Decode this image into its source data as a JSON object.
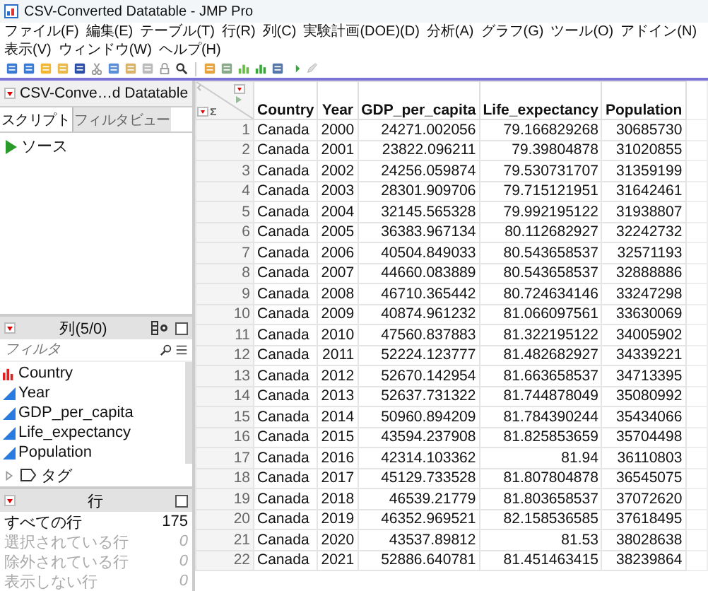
{
  "window": {
    "title": "CSV-Converted Datatable - JMP Pro"
  },
  "menu": [
    "ファイル(F)",
    "編集(E)",
    "テーブル(T)",
    "行(R)",
    "列(C)",
    "実験計画(DOE)(D)",
    "分析(A)",
    "グラフ(G)",
    "ツール(O)",
    "アドイン(N)",
    "表示(V)",
    "ウィンドウ(W)",
    "ヘルプ(H)"
  ],
  "table_panel": {
    "title": "CSV-Conve…d Datatable",
    "tabs": [
      {
        "label": "スクリプト",
        "selected": true
      },
      {
        "label": "フィルタビュー",
        "selected": false
      }
    ],
    "scripts": [
      "ソース"
    ]
  },
  "columns_panel": {
    "title": "列(5/0)",
    "filter": {
      "placeholder": "フィルタ"
    },
    "columns": [
      {
        "name": "Country",
        "kind": "nominal"
      },
      {
        "name": "Year",
        "kind": "continuous"
      },
      {
        "name": "GDP_per_capita",
        "kind": "continuous"
      },
      {
        "name": "Life_expectancy",
        "kind": "continuous"
      },
      {
        "name": "Population",
        "kind": "continuous"
      }
    ],
    "tags": "タグ"
  },
  "rows_panel": {
    "title": "行",
    "items": [
      {
        "label": "すべての行",
        "count": "175",
        "dimmed": false
      },
      {
        "label": "選択されている行",
        "count": "0",
        "dimmed": true
      },
      {
        "label": "除外されている行",
        "count": "0",
        "dimmed": true
      },
      {
        "label": "表示しない行",
        "count": "0",
        "dimmed": true
      }
    ]
  },
  "table": {
    "columns": [
      "Country",
      "Year",
      "GDP_per_capita",
      "Life_expectancy",
      "Population"
    ],
    "rows": [
      {
        "number": "1",
        "cells": [
          "Canada",
          "2000",
          "24271.002056",
          "79.166829268",
          "30685730"
        ]
      },
      {
        "number": "2",
        "cells": [
          "Canada",
          "2001",
          "23822.096211",
          "79.39804878",
          "31020855"
        ]
      },
      {
        "number": "3",
        "cells": [
          "Canada",
          "2002",
          "24256.059874",
          "79.530731707",
          "31359199"
        ]
      },
      {
        "number": "4",
        "cells": [
          "Canada",
          "2003",
          "28301.909706",
          "79.715121951",
          "31642461"
        ]
      },
      {
        "number": "5",
        "cells": [
          "Canada",
          "2004",
          "32145.565328",
          "79.992195122",
          "31938807"
        ]
      },
      {
        "number": "6",
        "cells": [
          "Canada",
          "2005",
          "36383.967134",
          "80.112682927",
          "32242732"
        ]
      },
      {
        "number": "7",
        "cells": [
          "Canada",
          "2006",
          "40504.849033",
          "80.543658537",
          "32571193"
        ]
      },
      {
        "number": "8",
        "cells": [
          "Canada",
          "2007",
          "44660.083889",
          "80.543658537",
          "32888886"
        ]
      },
      {
        "number": "9",
        "cells": [
          "Canada",
          "2008",
          "46710.365442",
          "80.724634146",
          "33247298"
        ]
      },
      {
        "number": "10",
        "cells": [
          "Canada",
          "2009",
          "40874.961232",
          "81.066097561",
          "33630069"
        ]
      },
      {
        "number": "11",
        "cells": [
          "Canada",
          "2010",
          "47560.837883",
          "81.322195122",
          "34005902"
        ]
      },
      {
        "number": "12",
        "cells": [
          "Canada",
          "2011",
          "52224.123777",
          "81.482682927",
          "34339221"
        ]
      },
      {
        "number": "13",
        "cells": [
          "Canada",
          "2012",
          "52670.142954",
          "81.663658537",
          "34713395"
        ]
      },
      {
        "number": "14",
        "cells": [
          "Canada",
          "2013",
          "52637.731322",
          "81.744878049",
          "35080992"
        ]
      },
      {
        "number": "15",
        "cells": [
          "Canada",
          "2014",
          "50960.894209",
          "81.784390244",
          "35434066"
        ]
      },
      {
        "number": "16",
        "cells": [
          "Canada",
          "2015",
          "43594.237908",
          "81.825853659",
          "35704498"
        ]
      },
      {
        "number": "17",
        "cells": [
          "Canada",
          "2016",
          "42314.103362",
          "81.94",
          "36110803"
        ]
      },
      {
        "number": "18",
        "cells": [
          "Canada",
          "2017",
          "45129.733528",
          "81.807804878",
          "36545075"
        ]
      },
      {
        "number": "19",
        "cells": [
          "Canada",
          "2018",
          "46539.21779",
          "81.803658537",
          "37072620"
        ]
      },
      {
        "number": "20",
        "cells": [
          "Canada",
          "2019",
          "46352.969521",
          "82.158536585",
          "37618495"
        ]
      },
      {
        "number": "21",
        "cells": [
          "Canada",
          "2020",
          "43537.89812",
          "81.53",
          "38028638"
        ]
      },
      {
        "number": "22",
        "cells": [
          "Canada",
          "2021",
          "52886.640781",
          "81.451463415",
          "38239864"
        ]
      }
    ]
  }
}
